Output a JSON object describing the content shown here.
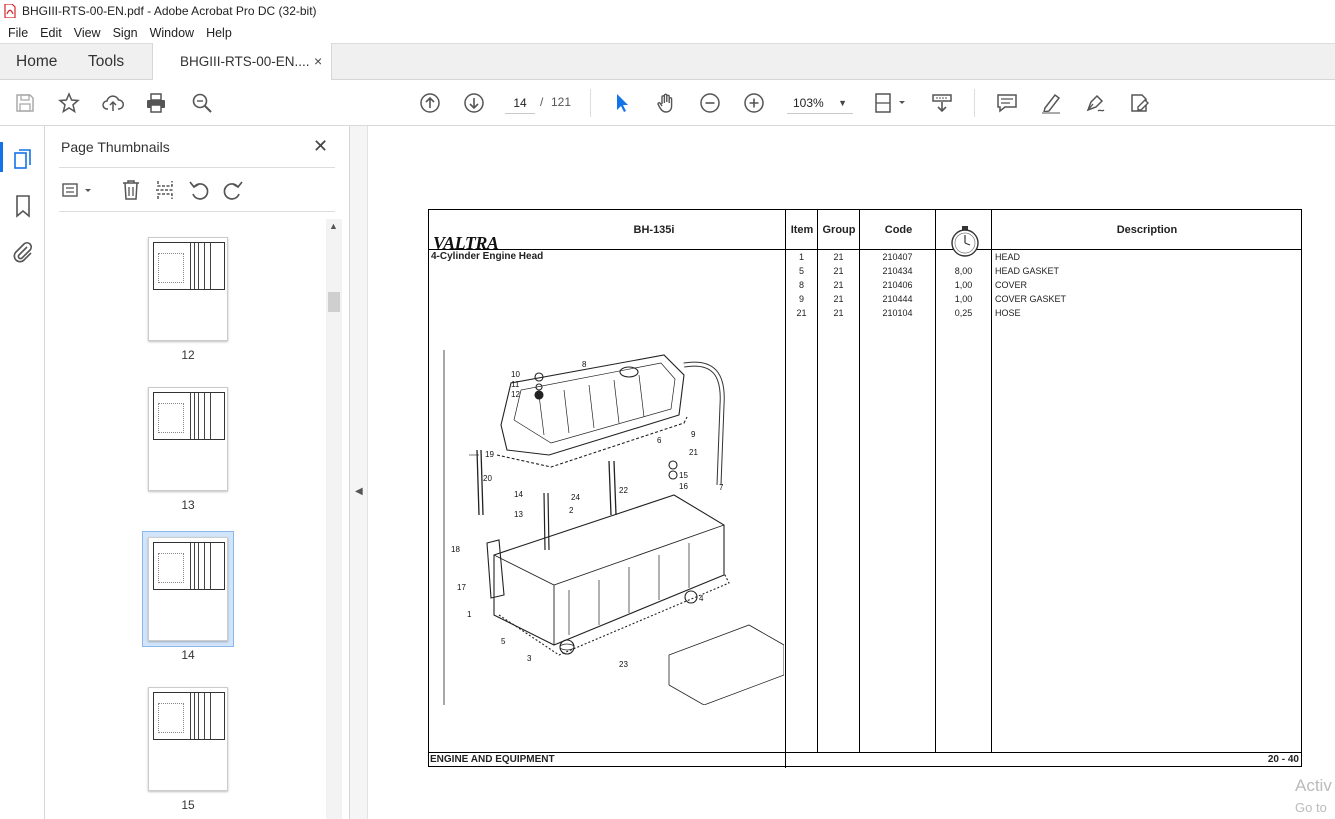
{
  "window": {
    "title": "BHGIII-RTS-00-EN.pdf - Adobe Acrobat Pro DC (32-bit)"
  },
  "menu": [
    "File",
    "Edit",
    "View",
    "Sign",
    "Window",
    "Help"
  ],
  "tabs": {
    "home": "Home",
    "tools": "Tools",
    "doc": "BHGIII-RTS-00-EN....",
    "close": "×"
  },
  "toolbar": {
    "page_current": "14",
    "page_sep": "/",
    "page_total": "121",
    "zoom": "103%"
  },
  "panel": {
    "title": "Page Thumbnails",
    "close": "✕",
    "thumbnails": [
      {
        "label": "12",
        "selected": false
      },
      {
        "label": "13",
        "selected": false
      },
      {
        "label": "14",
        "selected": true
      },
      {
        "label": "15",
        "selected": false
      }
    ]
  },
  "document": {
    "logo": "VALTRA",
    "model": "BH-135i",
    "subtitle": "4-Cylinder Engine Head",
    "columns": {
      "item": "Item",
      "group": "Group",
      "code": "Code",
      "description": "Description"
    },
    "rows": [
      {
        "item": "1",
        "group": "21",
        "code": "210407",
        "time": "",
        "description": "HEAD"
      },
      {
        "item": "5",
        "group": "21",
        "code": "210434",
        "time": "8,00",
        "description": "HEAD GASKET"
      },
      {
        "item": "8",
        "group": "21",
        "code": "210406",
        "time": "1,00",
        "description": "COVER"
      },
      {
        "item": "9",
        "group": "21",
        "code": "210444",
        "time": "1,00",
        "description": "COVER GASKET"
      },
      {
        "item": "21",
        "group": "21",
        "code": "210104",
        "time": "0,25",
        "description": "HOSE"
      }
    ],
    "callouts": [
      "10",
      "11",
      "12",
      "8",
      "19",
      "20",
      "14",
      "13",
      "21",
      "6",
      "24",
      "2",
      "22",
      "15",
      "16",
      "7",
      "18",
      "17",
      "1",
      "4",
      "5",
      "3",
      "23",
      "9"
    ],
    "footer_left": "ENGINE AND EQUIPMENT",
    "footer_right": "20 - 40"
  },
  "watermark": {
    "line1": "Activ",
    "line2": "Go to"
  }
}
